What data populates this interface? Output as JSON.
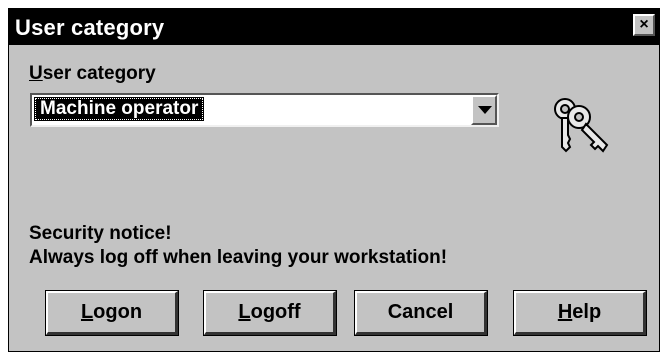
{
  "window": {
    "title": "User category",
    "close_label": "×"
  },
  "user_category": {
    "label_first": "U",
    "label_rest": "ser category",
    "selected_value": "Machine operator"
  },
  "icons": {
    "keys": "keys-icon",
    "dropdown": "chevron-down-icon",
    "close": "close-icon"
  },
  "notice": {
    "line1": "Security notice!",
    "line2": "Always log off when leaving your workstation!"
  },
  "buttons": {
    "logon": {
      "first": "L",
      "rest": "ogon"
    },
    "logoff": {
      "first": "L",
      "rest": "ogoff"
    },
    "cancel": {
      "label": "Cancel"
    },
    "help": {
      "first": "H",
      "rest": "elp"
    }
  },
  "colors": {
    "titlebar": "#000000",
    "face": "#c3c3c3",
    "selection": "#000000"
  }
}
